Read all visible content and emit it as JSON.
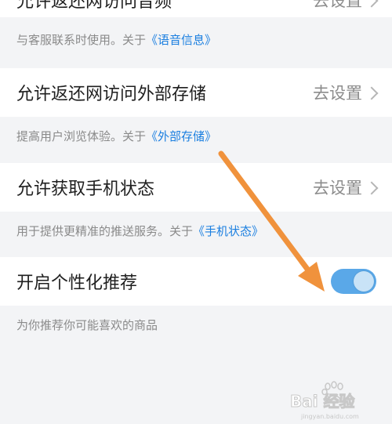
{
  "settings": [
    {
      "title": "允许返还网访问音频",
      "action": "去设置",
      "note_prefix": "与客服联系时使用。关于",
      "note_link": "《语音信息》"
    },
    {
      "title": "允许返还网访问外部存储",
      "action": "去设置",
      "note_prefix": "提高用户浏览体验。关于",
      "note_link": "《外部存储》"
    },
    {
      "title": "允许获取手机状态",
      "action": "去设置",
      "note_prefix": "用于提供更精准的推送服务。关于",
      "note_link": "《手机状态》"
    }
  ],
  "personalization": {
    "title": "开启个性化推荐",
    "enabled": true,
    "note": "为你推荐你可能喜欢的商品"
  },
  "watermark": {
    "text": "Bai 经验",
    "subtext": "jingyan.baidu.com"
  },
  "colors": {
    "background": "#f3f4f6",
    "link": "#1b7fe0",
    "toggle_on": "#5aa8e8",
    "annotation_arrow": "#f0923c"
  }
}
